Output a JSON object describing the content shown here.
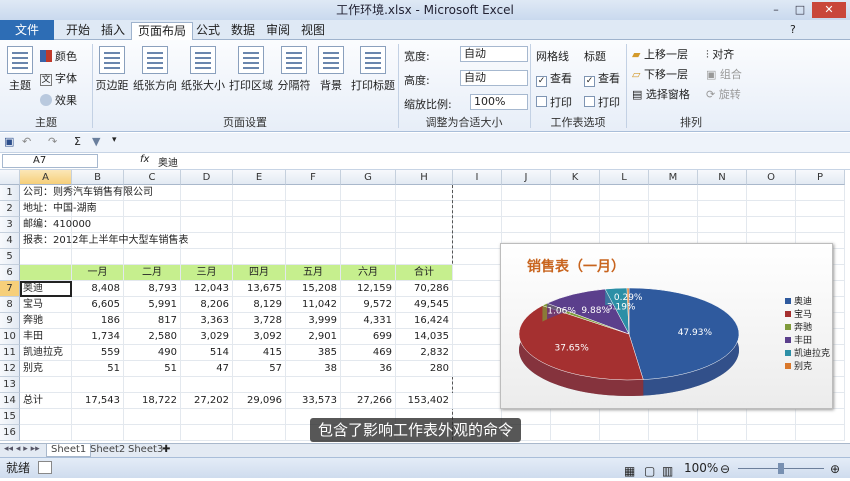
{
  "window": {
    "title": "工作环境.xlsx - Microsoft Excel"
  },
  "tabs": [
    "文件",
    "开始",
    "插入",
    "页面布局",
    "公式",
    "数据",
    "审阅",
    "视图"
  ],
  "ribbon": {
    "theme_group": {
      "label": "主题",
      "theme_btn": "主题",
      "colors": "颜色",
      "fonts": "字体",
      "effects": "效果"
    },
    "page_setup": {
      "label": "页面设置",
      "buttons": [
        "页边距",
        "纸张方向",
        "纸张大小",
        "打印区域",
        "分隔符",
        "背景",
        "打印标题"
      ]
    },
    "scale_fit": {
      "label": "调整为合适大小",
      "width_label": "宽度:",
      "width_value": "自动",
      "height_label": "高度:",
      "height_value": "自动",
      "scale_label": "缩放比例:",
      "scale_value": "100%"
    },
    "sheet_options": {
      "label": "工作表选项",
      "gridlines": "网格线",
      "headings": "标题",
      "view": "查看",
      "print": "打印"
    },
    "arrange": {
      "label": "排列",
      "bring_forward": "上移一层",
      "send_backward": "下移一层",
      "selection_pane": "选择窗格",
      "align": "对齐",
      "group": "组合",
      "rotate": "旋转"
    }
  },
  "formula_bar": {
    "name_box": "A7",
    "fx": "fx",
    "content": "奥迪"
  },
  "columns": [
    "A",
    "B",
    "C",
    "D",
    "E",
    "F",
    "G",
    "H",
    "I",
    "J",
    "K",
    "L",
    "M",
    "N",
    "O",
    "P"
  ],
  "rows": [
    "1",
    "2",
    "3",
    "4",
    "5",
    "6",
    "7",
    "8",
    "9",
    "10",
    "11",
    "12",
    "13",
    "14",
    "15",
    "16"
  ],
  "info": [
    "公司：则秀汽车销售有限公司",
    "地址：中国-湖南",
    "邮编：410000",
    "报表：2012年上半年中大型车销售表"
  ],
  "table": {
    "headers": [
      "一月",
      "二月",
      "三月",
      "四月",
      "五月",
      "六月",
      "合计"
    ],
    "rows": [
      {
        "name": "奥迪",
        "values": [
          "8,408",
          "8,793",
          "12,043",
          "13,675",
          "15,208",
          "12,159",
          "70,286"
        ]
      },
      {
        "name": "宝马",
        "values": [
          "6,605",
          "5,991",
          "8,206",
          "8,129",
          "11,042",
          "9,572",
          "49,545"
        ]
      },
      {
        "name": "奔驰",
        "values": [
          "186",
          "817",
          "3,363",
          "3,728",
          "3,999",
          "4,331",
          "16,424"
        ]
      },
      {
        "name": "丰田",
        "values": [
          "1,734",
          "2,580",
          "3,029",
          "3,092",
          "2,901",
          "699",
          "14,035"
        ]
      },
      {
        "name": "凯迪拉克",
        "values": [
          "559",
          "490",
          "514",
          "415",
          "385",
          "469",
          "2,832"
        ]
      },
      {
        "name": "别克",
        "values": [
          "51",
          "51",
          "47",
          "57",
          "38",
          "36",
          "280"
        ]
      }
    ],
    "total": {
      "name": "总计",
      "values": [
        "17,543",
        "18,722",
        "27,202",
        "29,096",
        "33,573",
        "27,266",
        "153,402"
      ]
    }
  },
  "chart_data": {
    "type": "pie",
    "title": "销售表（一月）",
    "categories": [
      "奥迪",
      "宝马",
      "奔驰",
      "丰田",
      "凯迪拉克",
      "别克"
    ],
    "values": [
      47.93,
      37.65,
      1.06,
      9.88,
      3.19,
      0.29
    ],
    "data_labels": [
      "47.93%",
      "37.65%",
      "1.06%",
      "9.88%",
      "3.19%",
      "0.29%"
    ],
    "colors": [
      "#2f5a9e",
      "#a53030",
      "#7f9a3a",
      "#5b3f8c",
      "#2c8fa6",
      "#d9782c"
    ],
    "legend_position": "right"
  },
  "sheets": [
    "Sheet1",
    "Sheet2",
    "Sheet3"
  ],
  "status": {
    "ready": "就绪",
    "zoom": "100%"
  },
  "subtitle": "包含了影响工作表外观的命令"
}
